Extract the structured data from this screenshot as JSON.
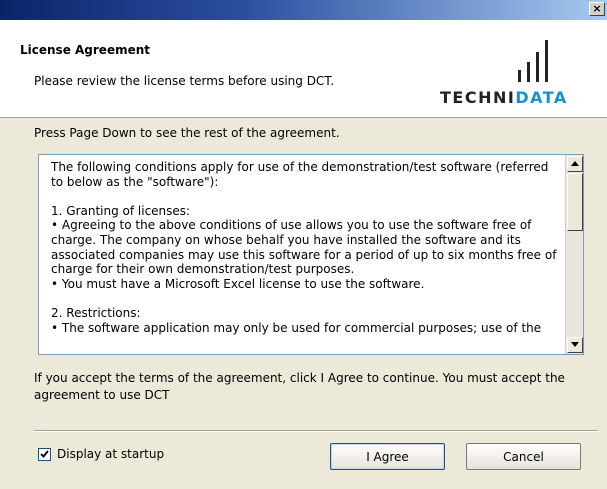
{
  "window": {
    "close_label": "×"
  },
  "header": {
    "title": "License Agreement",
    "subtitle": "Please review the license terms before using DCT.",
    "logo_text_dark": "TECHNI",
    "logo_text_accent": "DATA"
  },
  "body": {
    "instruction": "Press Page Down to see the rest of the agreement.",
    "license_lines": [
      "The following conditions apply for use of the demonstration/test software (referred to below as the \"software\"):",
      "",
      "1. Granting of licenses:",
      "• Agreeing to the above conditions of use allows you to use the software free of charge. The company on whose behalf you have installed the software and its associated companies may use this software for a period of up to six months free of charge for their own demonstration/test purposes.",
      "• You must have a Microsoft Excel license to use the software.",
      "",
      "2. Restrictions:",
      "• The software application may only be used for commercial purposes; use of the"
    ],
    "accept_text": "If you accept the terms of the agreement, click I Agree to continue. You must accept the agreement to use DCT"
  },
  "footer": {
    "checkbox_label": "Display at startup",
    "checkbox_checked": true,
    "agree_label": "I Agree",
    "cancel_label": "Cancel"
  },
  "colors": {
    "logo_accent": "#1a8fd1",
    "titlebar": "#0a246a"
  },
  "icons": {
    "close": "close-icon",
    "scroll_up": "scroll-up-arrow-icon",
    "scroll_down": "scroll-down-arrow-icon",
    "check": "check-icon"
  }
}
